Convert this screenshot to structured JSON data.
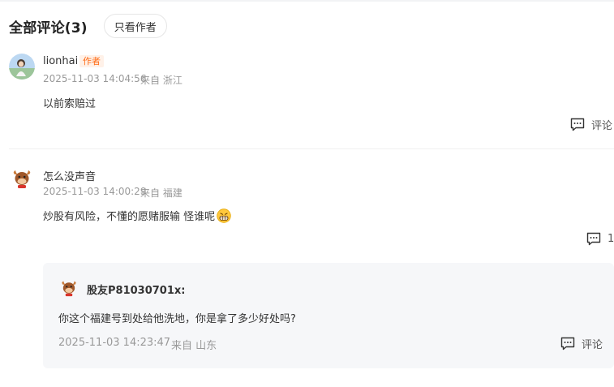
{
  "header": {
    "title": "全部评论(3)",
    "filter_label": "只看作者"
  },
  "comments": [
    {
      "username": "lionhai",
      "badge": "作者",
      "time": "2025-11-03 14:04:56",
      "location": "来自 浙江",
      "text": "以前索赔过",
      "action_label": "评论"
    },
    {
      "username": "怎么没声音",
      "time": "2025-11-03 14:00:29",
      "location": "来自 福建",
      "text": "炒股有风险，不懂的愿赌服输 怪谁呢",
      "emoji_icon": "grimace-emoji-icon",
      "reply_count": "1",
      "replies": [
        {
          "username": "股友P81030701x:",
          "text": "你这个福建号到处给他洗地，你是拿了多少好处吗?",
          "time": "2025-11-03 14:23:47",
          "location": "来自 山东",
          "action_label": "评论"
        }
      ]
    }
  ],
  "colors": {
    "author_badge": "#ff6a13",
    "meta_text": "#999999",
    "reply_bg": "#f6f7f9"
  }
}
